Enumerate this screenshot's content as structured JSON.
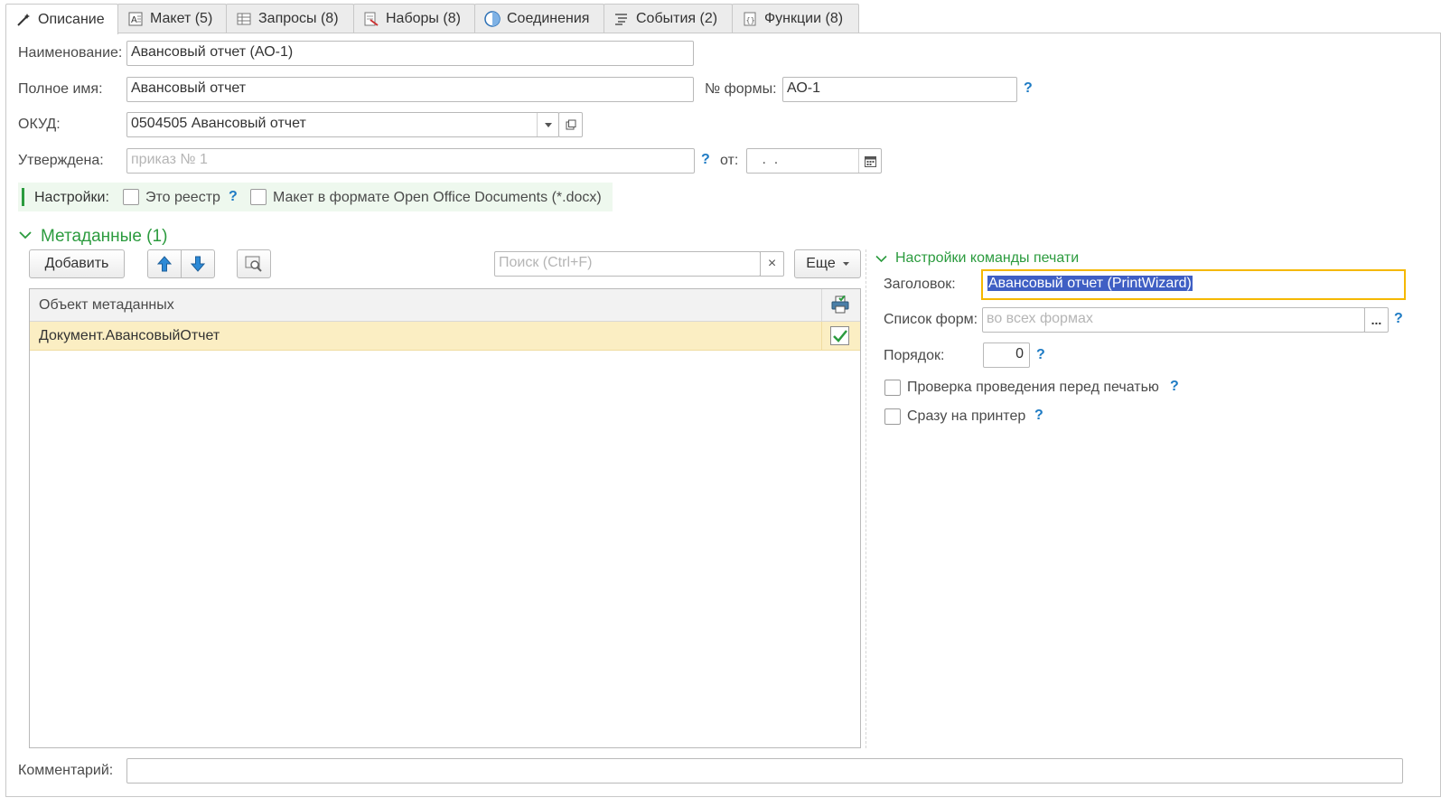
{
  "tabs": [
    {
      "label": "Описание",
      "icon": "wand-icon"
    },
    {
      "label": "Макет (5)",
      "icon": "layout-icon"
    },
    {
      "label": "Запросы (8)",
      "icon": "table-icon"
    },
    {
      "label": "Наборы (8)",
      "icon": "dataset-icon"
    },
    {
      "label": "Соединения",
      "icon": "connection-icon"
    },
    {
      "label": "События (2)",
      "icon": "events-icon"
    },
    {
      "label": "Функции (8)",
      "icon": "functions-icon"
    }
  ],
  "form": {
    "name_label": "Наименование:",
    "name_value": "Авансовый отчет (АО-1)",
    "fullname_label": "Полное имя:",
    "fullname_value": "Авансовый отчет",
    "formno_label": "№ формы:",
    "formno_value": "АО-1",
    "okud_label": "ОКУД:",
    "okud_value": "0504505 Авансовый отчет",
    "approved_label": "Утверждена:",
    "approved_placeholder": "приказ № 1",
    "from_label": "от:",
    "date_value": " .  .",
    "help": "?"
  },
  "settings": {
    "label": "Настройки:",
    "registry_label": "Это реестр",
    "docx_label": "Макет в формате Open Office Documents (*.docx)"
  },
  "metadata": {
    "title": "Метаданные (1)",
    "add_label": "Добавить",
    "search_placeholder": "Поиск (Ctrl+F)",
    "clear": "×",
    "more_label": "Еще",
    "column_header": "Объект метаданных",
    "rows": [
      {
        "name": "Документ.АвансовыйОтчет",
        "checked": true
      }
    ]
  },
  "print": {
    "title": "Настройки команды печати",
    "header_label": "Заголовок:",
    "header_value": "Авансовый отчет (PrintWizard)",
    "forms_label": "Список форм:",
    "forms_placeholder": "во всех формах",
    "forms_button": "...",
    "order_label": "Порядок:",
    "order_value": "0",
    "check_posting_label": "Проверка проведения перед печатью",
    "direct_print_label": "Сразу на принтер"
  },
  "comment": {
    "label": "Комментарий:"
  },
  "colors": {
    "accent_green": "#2b9b3e",
    "help_blue": "#1e7bc4",
    "selected_row": "#fbeec3",
    "focus_border": "#f5b800",
    "selection_bg": "#3f5fc4"
  }
}
